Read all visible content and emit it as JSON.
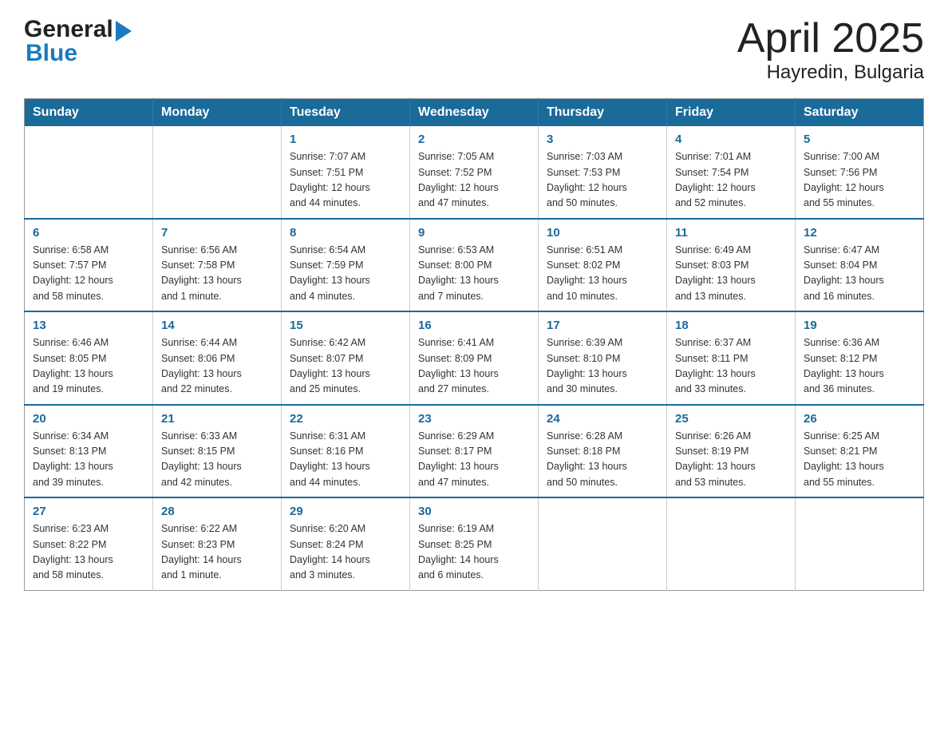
{
  "header": {
    "logo_text_general": "General",
    "logo_text_blue": "Blue",
    "title": "April 2025",
    "subtitle": "Hayredin, Bulgaria"
  },
  "calendar": {
    "weekdays": [
      "Sunday",
      "Monday",
      "Tuesday",
      "Wednesday",
      "Thursday",
      "Friday",
      "Saturday"
    ],
    "weeks": [
      [
        {
          "day": "",
          "info": ""
        },
        {
          "day": "",
          "info": ""
        },
        {
          "day": "1",
          "info": "Sunrise: 7:07 AM\nSunset: 7:51 PM\nDaylight: 12 hours\nand 44 minutes."
        },
        {
          "day": "2",
          "info": "Sunrise: 7:05 AM\nSunset: 7:52 PM\nDaylight: 12 hours\nand 47 minutes."
        },
        {
          "day": "3",
          "info": "Sunrise: 7:03 AM\nSunset: 7:53 PM\nDaylight: 12 hours\nand 50 minutes."
        },
        {
          "day": "4",
          "info": "Sunrise: 7:01 AM\nSunset: 7:54 PM\nDaylight: 12 hours\nand 52 minutes."
        },
        {
          "day": "5",
          "info": "Sunrise: 7:00 AM\nSunset: 7:56 PM\nDaylight: 12 hours\nand 55 minutes."
        }
      ],
      [
        {
          "day": "6",
          "info": "Sunrise: 6:58 AM\nSunset: 7:57 PM\nDaylight: 12 hours\nand 58 minutes."
        },
        {
          "day": "7",
          "info": "Sunrise: 6:56 AM\nSunset: 7:58 PM\nDaylight: 13 hours\nand 1 minute."
        },
        {
          "day": "8",
          "info": "Sunrise: 6:54 AM\nSunset: 7:59 PM\nDaylight: 13 hours\nand 4 minutes."
        },
        {
          "day": "9",
          "info": "Sunrise: 6:53 AM\nSunset: 8:00 PM\nDaylight: 13 hours\nand 7 minutes."
        },
        {
          "day": "10",
          "info": "Sunrise: 6:51 AM\nSunset: 8:02 PM\nDaylight: 13 hours\nand 10 minutes."
        },
        {
          "day": "11",
          "info": "Sunrise: 6:49 AM\nSunset: 8:03 PM\nDaylight: 13 hours\nand 13 minutes."
        },
        {
          "day": "12",
          "info": "Sunrise: 6:47 AM\nSunset: 8:04 PM\nDaylight: 13 hours\nand 16 minutes."
        }
      ],
      [
        {
          "day": "13",
          "info": "Sunrise: 6:46 AM\nSunset: 8:05 PM\nDaylight: 13 hours\nand 19 minutes."
        },
        {
          "day": "14",
          "info": "Sunrise: 6:44 AM\nSunset: 8:06 PM\nDaylight: 13 hours\nand 22 minutes."
        },
        {
          "day": "15",
          "info": "Sunrise: 6:42 AM\nSunset: 8:07 PM\nDaylight: 13 hours\nand 25 minutes."
        },
        {
          "day": "16",
          "info": "Sunrise: 6:41 AM\nSunset: 8:09 PM\nDaylight: 13 hours\nand 27 minutes."
        },
        {
          "day": "17",
          "info": "Sunrise: 6:39 AM\nSunset: 8:10 PM\nDaylight: 13 hours\nand 30 minutes."
        },
        {
          "day": "18",
          "info": "Sunrise: 6:37 AM\nSunset: 8:11 PM\nDaylight: 13 hours\nand 33 minutes."
        },
        {
          "day": "19",
          "info": "Sunrise: 6:36 AM\nSunset: 8:12 PM\nDaylight: 13 hours\nand 36 minutes."
        }
      ],
      [
        {
          "day": "20",
          "info": "Sunrise: 6:34 AM\nSunset: 8:13 PM\nDaylight: 13 hours\nand 39 minutes."
        },
        {
          "day": "21",
          "info": "Sunrise: 6:33 AM\nSunset: 8:15 PM\nDaylight: 13 hours\nand 42 minutes."
        },
        {
          "day": "22",
          "info": "Sunrise: 6:31 AM\nSunset: 8:16 PM\nDaylight: 13 hours\nand 44 minutes."
        },
        {
          "day": "23",
          "info": "Sunrise: 6:29 AM\nSunset: 8:17 PM\nDaylight: 13 hours\nand 47 minutes."
        },
        {
          "day": "24",
          "info": "Sunrise: 6:28 AM\nSunset: 8:18 PM\nDaylight: 13 hours\nand 50 minutes."
        },
        {
          "day": "25",
          "info": "Sunrise: 6:26 AM\nSunset: 8:19 PM\nDaylight: 13 hours\nand 53 minutes."
        },
        {
          "day": "26",
          "info": "Sunrise: 6:25 AM\nSunset: 8:21 PM\nDaylight: 13 hours\nand 55 minutes."
        }
      ],
      [
        {
          "day": "27",
          "info": "Sunrise: 6:23 AM\nSunset: 8:22 PM\nDaylight: 13 hours\nand 58 minutes."
        },
        {
          "day": "28",
          "info": "Sunrise: 6:22 AM\nSunset: 8:23 PM\nDaylight: 14 hours\nand 1 minute."
        },
        {
          "day": "29",
          "info": "Sunrise: 6:20 AM\nSunset: 8:24 PM\nDaylight: 14 hours\nand 3 minutes."
        },
        {
          "day": "30",
          "info": "Sunrise: 6:19 AM\nSunset: 8:25 PM\nDaylight: 14 hours\nand 6 minutes."
        },
        {
          "day": "",
          "info": ""
        },
        {
          "day": "",
          "info": ""
        },
        {
          "day": "",
          "info": ""
        }
      ]
    ]
  }
}
